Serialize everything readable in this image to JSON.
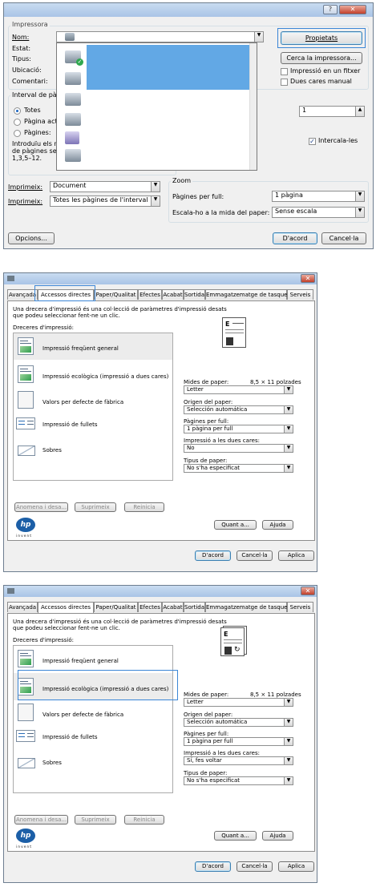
{
  "print_dialog": {
    "help_btn": "?",
    "close_btn": "✕",
    "printer_group": "Impressora",
    "name_label": "Nom:",
    "status_label": "Estat:",
    "type_label": "Tipus:",
    "location_label": "Ubicació:",
    "comment_label": "Comentari:",
    "printer_value": "",
    "properties_btn": "Propietats",
    "find_printer_btn": "Cerca la impressora...",
    "print_to_file": "Impressió en un fitxer",
    "manual_duplex": "Dues cares manual",
    "range_group": "Interval de pàg",
    "all_pages": "Totes",
    "current_page": "Pàgina act",
    "pages": "Pàgines:",
    "pages_hint_1": "Introduïu els n",
    "pages_hint_2": "de pàgines se",
    "pages_hint_3": "1,3,5–12.",
    "copies_value": "1",
    "collate": "Intercala-les",
    "print_what_label": "Imprimeix:",
    "print_what_value": "Document",
    "print_label": "Imprimeix:",
    "print_value": "Totes les pàgines de l'interval",
    "zoom_group": "Zoom",
    "pages_per_sheet_label": "Pàgines per full:",
    "pages_per_sheet_value": "1 pàgina",
    "scale_label": "Escala-ho a la mida del paper:",
    "scale_value": "Sense escala",
    "options_btn": "Opcions...",
    "ok_btn": "D'acord",
    "cancel_btn": "Cancel·la"
  },
  "props": {
    "close_btn": "✕",
    "tabs": [
      "Avançada",
      "Accessos directes",
      "Paper/Qualitat",
      "Efectes",
      "Acabat",
      "Sortida",
      "Emmagatzematge de tasques",
      "Serveis"
    ],
    "desc_1": "Una drecera d'impressió és una col·lecció de paràmetres d'impressió desats",
    "desc_2": "que podeu seleccionar fent-ne un clic.",
    "shortcuts_label": "Dreceres d'impressió:",
    "shortcuts": [
      "Impressió freqüent general",
      "Impressió ecològica (impressió a dues cares)",
      "Valors per defecte de fàbrica",
      "Impressió de fullets",
      "Sobres"
    ],
    "paper_size_label": "Mides de paper:",
    "paper_size_dim": "8,5 × 11 polzades",
    "paper_size_value": "Letter",
    "paper_source_label": "Origen del paper:",
    "paper_source_value": "Selección automática",
    "pps_label": "Pàgines per full:",
    "pps_value": "1 pàgina per full",
    "duplex_label": "Impressió a les dues cares:",
    "paper_type_label": "Tipus de paper:",
    "paper_type_value": "No s'ha especificat",
    "save_as_btn": "Anomena i desa...",
    "delete_btn": "Suprimeix",
    "reset_btn": "Reinicia",
    "hp_logo": "hp",
    "hp_tagline": "i n v e n t",
    "about_btn": "Quant a...",
    "help_btn": "Ajuda",
    "ok_btn": "D'acord",
    "cancel_btn": "Cancel·la",
    "apply_btn": "Aplica"
  },
  "props1": {
    "duplex_value": "No"
  },
  "props2": {
    "duplex_value": "Sí, fes voltar"
  }
}
